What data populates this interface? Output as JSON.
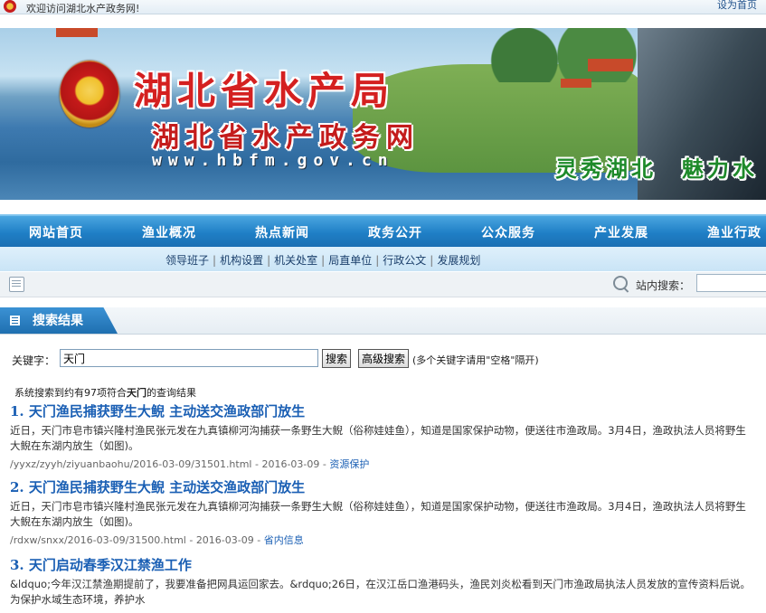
{
  "topbar": {
    "welcome": "欢迎访问湖北水产政务网!",
    "homepage": "设为首页"
  },
  "banner": {
    "title": "湖北省水产局",
    "subtitle": "湖北省水产政务网",
    "url": "www.hbfm.gov.cn",
    "slogan": "灵秀湖北　魅力水"
  },
  "nav": {
    "items": [
      "网站首页",
      "渔业概况",
      "热点新闻",
      "政务公开",
      "公众服务",
      "产业发展",
      "渔业行政"
    ],
    "sub_items": [
      "领导班子",
      "机构设置",
      "机关处室",
      "局直单位",
      "行政公文",
      "发展规划"
    ],
    "separator": "|"
  },
  "toolbar": {
    "site_search_label": "站内搜索："
  },
  "results": {
    "heading": "搜索结果",
    "keyword_label": "关键字：",
    "keyword_value": "天门",
    "search_button": "搜索",
    "advanced_button": "高级搜索",
    "hint": "(多个关键字请用\"空格\"隔开)",
    "summary_pre": "系统搜索到约有97项符合",
    "summary_kw": "天门",
    "summary_post": "的查询结果",
    "items": [
      {
        "title": "1. 天门渔民捕获野生大鲵 主动送交渔政部门放生",
        "snippet": "近日，天门市皂市镇兴隆村渔民张元发在九真镇柳河沟捕获一条野生大鲵（俗称娃娃鱼），知道是国家保护动物，便送往市渔政局。3月4日，渔政执法人员将野生大鲵在东湖内放生（如图)。",
        "url": "/yyxz/zyyh/ziyuanbaohu/2016-03-09/31501.html",
        "date": "2016-03-09",
        "category": "资源保护"
      },
      {
        "title": "2. 天门渔民捕获野生大鲵 主动送交渔政部门放生",
        "snippet": "近日，天门市皂市镇兴隆村渔民张元发在九真镇柳河沟捕获一条野生大鲵（俗称娃娃鱼），知道是国家保护动物，便送往市渔政局。3月4日，渔政执法人员将野生大鲵在东湖内放生（如图)。",
        "url": "/rdxw/snxx/2016-03-09/31500.html",
        "date": "2016-03-09",
        "category": "省内信息"
      },
      {
        "title": "3. 天门启动春季汉江禁渔工作",
        "snippet": "&ldquo;今年汉江禁渔期提前了，我要准备把网具运回家去。&rdquo;26日，在汉江岳口渔港码头，渔民刘炎松看到天门市渔政局执法人员发放的宣传资料后说。为保护水域生态环境，养护水",
        "url": "",
        "date": "",
        "category": ""
      }
    ]
  }
}
